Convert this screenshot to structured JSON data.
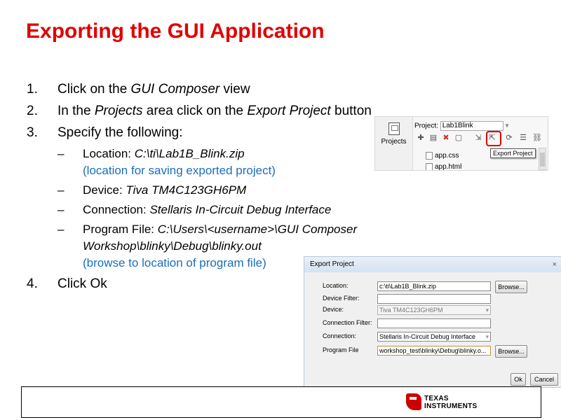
{
  "title": "Exporting the GUI Application",
  "steps": {
    "s1": {
      "num": "1.",
      "pre": "Click on the ",
      "em": "GUI Composer",
      "post": " view"
    },
    "s2": {
      "num": "2.",
      "pre": "In the ",
      "em1": "Projects",
      "mid": " area click on the ",
      "em2": "Export Project",
      "post": " button"
    },
    "s3": {
      "num": "3.",
      "text": "Specify the following:"
    },
    "s4": {
      "num": "4.",
      "text": "Click Ok"
    },
    "subs": {
      "dash": "–",
      "location": {
        "label": "Location: ",
        "value": "C:\\ti\\Lab1B_Blink.zip",
        "note": "(location for saving exported project)"
      },
      "device": {
        "label": "Device: ",
        "value": "Tiva TM4C123GH6PM"
      },
      "connection": {
        "label": "Connection: ",
        "value": "Stellaris In-Circuit Debug Interface"
      },
      "program": {
        "label": "Program File: ",
        "value1": "C:\\Users\\<username>\\GUI Composer",
        "value2": "Workshop\\blinky\\Debug\\blinky.out",
        "note": "(browse to location of program file)"
      }
    }
  },
  "projects_panel": {
    "tab_label": "Projects",
    "project_label": "Project:",
    "project_name": "Lab1Blink",
    "tooltip": "Export Project",
    "files": [
      "app.css",
      "app.html"
    ]
  },
  "export_dialog": {
    "title": "Export Project",
    "close_glyph": "×",
    "fields": {
      "location": {
        "label": "Location:",
        "value": "c:\\ti\\Lab1B_Blink.zip"
      },
      "device_filter": {
        "label": "Device Filter:",
        "value": ""
      },
      "device": {
        "label": "Device:",
        "value": "Tiva TM4C123GH6PM"
      },
      "connection_filter": {
        "label": "Connection Filter:",
        "value": ""
      },
      "connection": {
        "label": "Connection:",
        "value": "Stellaris In-Circuit Debug Interface"
      },
      "program_file": {
        "label": "Program File",
        "value": "workshop_test\\blinky\\Debug\\blinky.o..."
      }
    },
    "browse_label": "Browse...",
    "ok_label": "Ok",
    "cancel_label": "Cancel"
  },
  "footer": {
    "logo_line1": "TEXAS",
    "logo_line2": "INSTRUMENTS",
    "logo_color": "#cc0000"
  },
  "colors": {
    "title": "#e00000",
    "note": "#1a6ebd"
  }
}
